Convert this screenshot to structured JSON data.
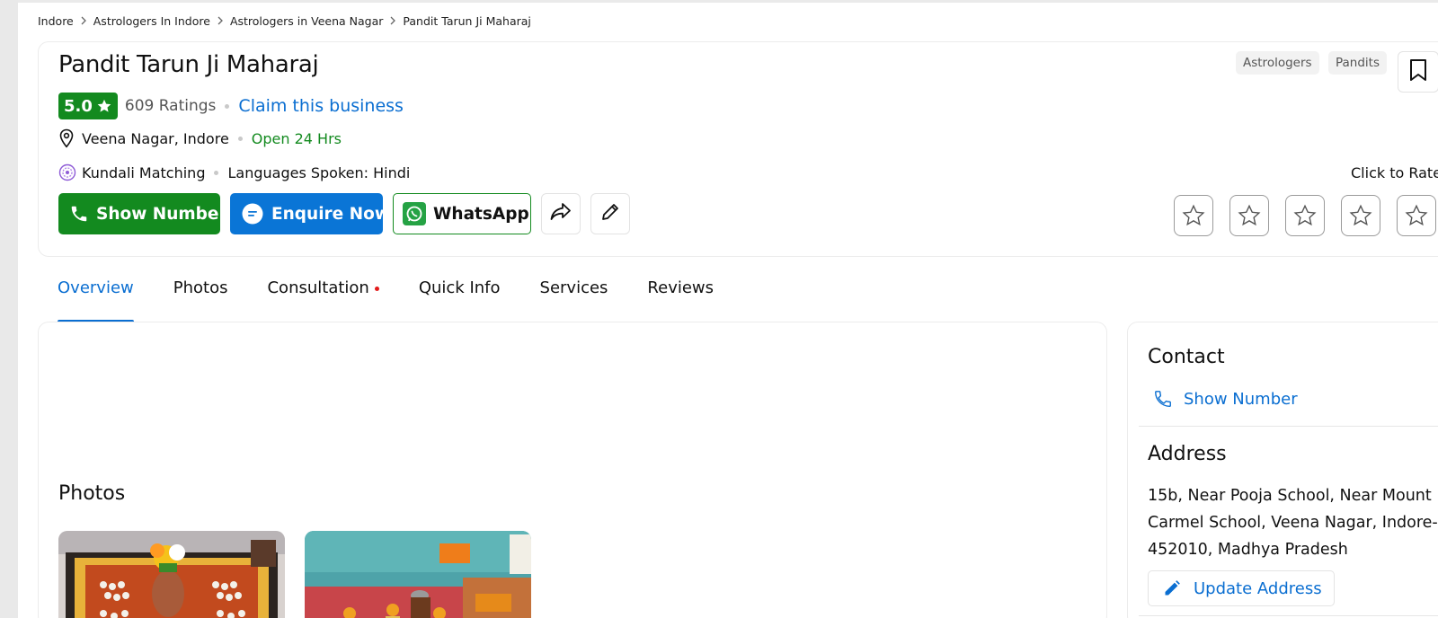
{
  "breadcrumb": [
    "Indore",
    "Astrologers In Indore",
    "Astrologers in Veena Nagar",
    "Pandit Tarun Ji Maharaj"
  ],
  "business": {
    "name": "Pandit Tarun Ji Maharaj",
    "rating": "5.0",
    "ratings_count": "609 Ratings",
    "claim_label": "Claim this business",
    "location": "Veena Nagar, Indore",
    "hours": "Open 24 Hrs",
    "service": "Kundali Matching",
    "languages": "Languages Spoken: Hindi",
    "tags": [
      "Astrologers",
      "Pandits"
    ]
  },
  "actions": {
    "show_number": "Show Number",
    "enquire": "Enquire Now",
    "whatsapp": "WhatsApp",
    "share_icon": "share-icon",
    "edit_icon": "pencil-icon"
  },
  "rate": {
    "label": "Click to Rate",
    "stars": 5
  },
  "tabs": [
    {
      "label": "Overview",
      "active": true
    },
    {
      "label": "Photos",
      "active": false
    },
    {
      "label": "Consultation",
      "active": false,
      "badge": true
    },
    {
      "label": "Quick Info",
      "active": false
    },
    {
      "label": "Services",
      "active": false
    },
    {
      "label": "Reviews",
      "active": false
    }
  ],
  "main": {
    "photos_title": "Photos"
  },
  "sidebar": {
    "contact_title": "Contact",
    "show_number": "Show Number",
    "address_title": "Address",
    "address": "15b, Near Pooja School, Near Mount Carmel School, Veena Nagar, Indore-452010, Madhya Pradesh",
    "update_address": "Update Address"
  },
  "colors": {
    "green": "#138a1f",
    "blue": "#0a75d6",
    "link": "#0a6ed1"
  }
}
